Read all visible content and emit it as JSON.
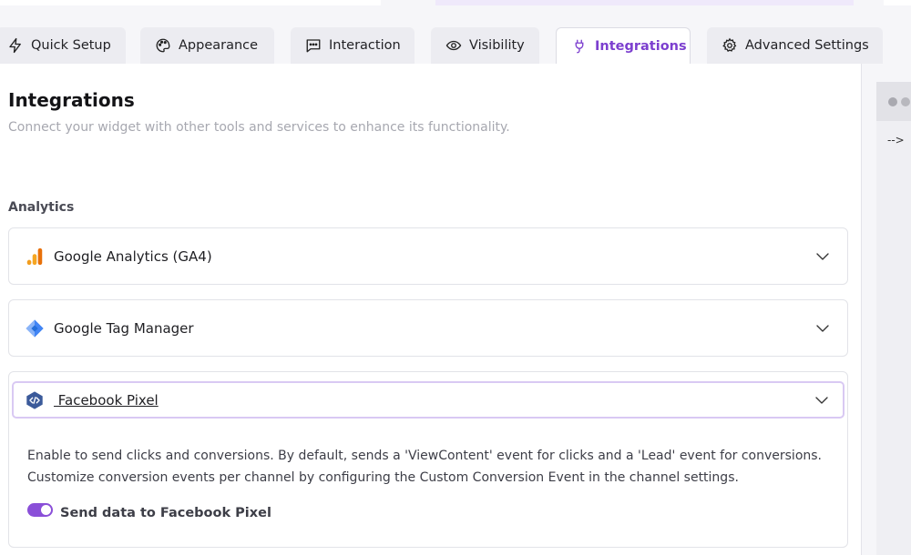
{
  "tabs": [
    {
      "label": "Quick Setup",
      "icon": "bolt-icon",
      "active": false
    },
    {
      "label": "Appearance",
      "icon": "palette-icon",
      "active": false
    },
    {
      "label": "Interaction",
      "icon": "chat-icon",
      "active": false
    },
    {
      "label": "Visibility",
      "icon": "eye-icon",
      "active": false
    },
    {
      "label": "Integrations",
      "icon": "plug-icon",
      "active": true
    },
    {
      "label": "Advanced Settings",
      "icon": "gear-icon",
      "active": false
    }
  ],
  "page": {
    "title": "Integrations",
    "subtitle": "Connect your widget with other tools and services to enhance its functionality."
  },
  "analytics": {
    "section_label": "Analytics",
    "items": [
      {
        "name": "Google Analytics (GA4)",
        "icon": "google-analytics-icon",
        "expanded": false
      },
      {
        "name": "Google Tag Manager",
        "icon": "google-tag-manager-icon",
        "expanded": false
      },
      {
        "name": " Facebook Pixel",
        "icon": "facebook-pixel-icon",
        "expanded": true,
        "description_line1": "Enable to send clicks and conversions. By default, sends a 'ViewContent' event for clicks and a 'Lead' event for conversions.",
        "description_line2": "Customize conversion events per channel by configuring the Custom Conversion Event in the channel settings.",
        "toggle_label": "Send data to Facebook Pixel",
        "toggle_on": true
      }
    ]
  },
  "preview": {
    "text": "-->"
  },
  "colors": {
    "accent": "#7c3fcf",
    "toggle": "#8a4fd8",
    "focus_border": "#d9c9f3"
  }
}
